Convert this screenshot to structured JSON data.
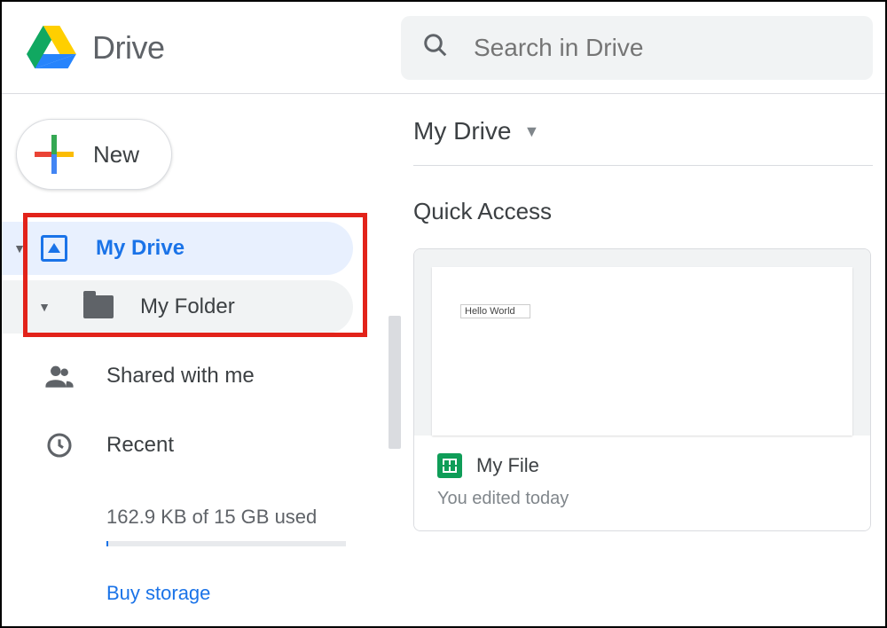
{
  "header": {
    "app_title": "Drive",
    "search_placeholder": "Search in Drive"
  },
  "sidebar": {
    "new_label": "New",
    "items": [
      {
        "label": "My Drive"
      },
      {
        "label": "My Folder"
      },
      {
        "label": "Shared with me"
      },
      {
        "label": "Recent"
      }
    ],
    "storage_text": "162.9 KB of 15 GB used",
    "buy_label": "Buy storage"
  },
  "main": {
    "breadcrumb": "My Drive",
    "quick_access_title": "Quick Access",
    "file": {
      "thumb_text": "Hello World",
      "name": "My File",
      "subtitle": "You edited today"
    }
  }
}
